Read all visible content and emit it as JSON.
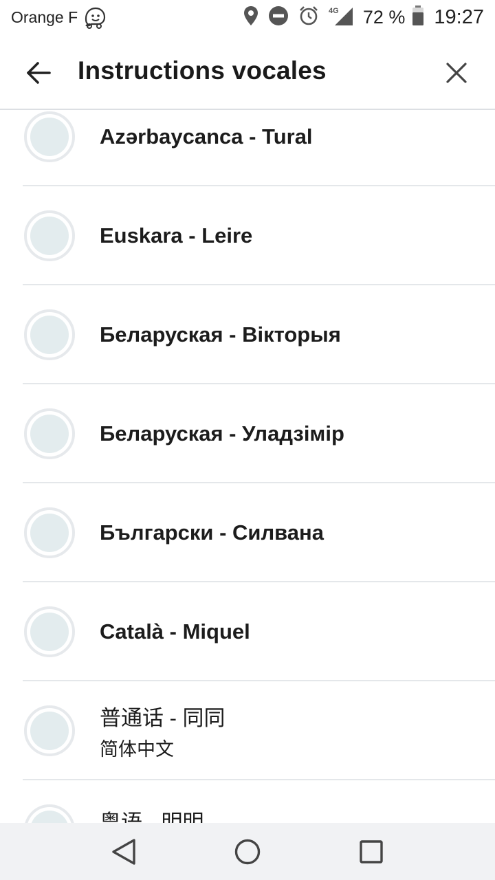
{
  "status_bar": {
    "carrier": "Orange F",
    "battery_text": "72 %",
    "time": "19:27",
    "network": "4G",
    "icons": [
      "waze-icon",
      "location-icon",
      "do-not-disturb-icon",
      "alarm-icon",
      "signal-icon",
      "battery-icon"
    ]
  },
  "app_bar": {
    "title": "Instructions vocales",
    "back_icon": "arrow-left-icon",
    "close_icon": "close-icon"
  },
  "voices": [
    {
      "label": "Azərbaycanca - Tural",
      "sub": ""
    },
    {
      "label": "Euskara - Leire",
      "sub": ""
    },
    {
      "label": "Беларуская - Вікторыя",
      "sub": ""
    },
    {
      "label": "Беларуская - Уладзімір",
      "sub": ""
    },
    {
      "label": "Български - Силвана",
      "sub": ""
    },
    {
      "label": "Català - Miquel",
      "sub": ""
    },
    {
      "label": "普通话 - 同同",
      "sub": "简体中文"
    },
    {
      "label": "粤语 - 明明",
      "sub": ""
    }
  ],
  "nav_bar": {
    "icons": [
      "back-triangle-icon",
      "home-circle-icon",
      "recents-square-icon"
    ]
  },
  "colors": {
    "radio_fill": "#e3ecee",
    "radio_border": "#e6e9ec",
    "divider": "#e4e7ea",
    "nav_bg": "#f1f2f4"
  }
}
